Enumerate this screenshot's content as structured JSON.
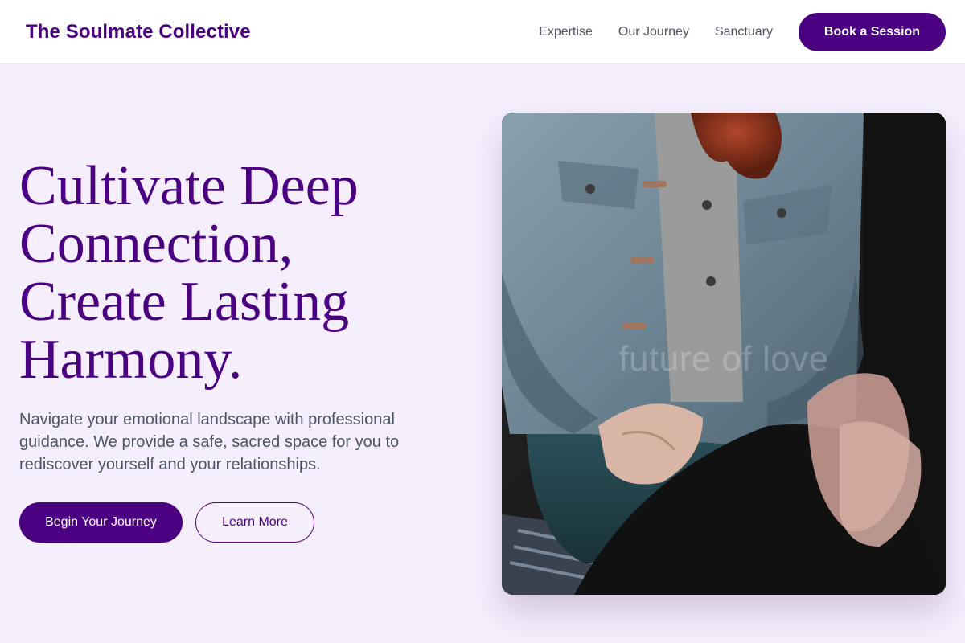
{
  "header": {
    "brand": "The Soulmate Collective",
    "nav": [
      {
        "label": "Expertise"
      },
      {
        "label": "Our Journey"
      },
      {
        "label": "Sanctuary"
      }
    ],
    "cta_label": "Book a Session"
  },
  "hero": {
    "title_lines": [
      "Cultivate Deep",
      "Connection,",
      "Create Lasting",
      "Harmony."
    ],
    "description": "Navigate your emotional landscape with professional guidance. We provide a safe, sacred space for you to rediscover yourself and your relationships.",
    "primary_label": "Begin Your Journey",
    "secondary_label": "Learn More",
    "image_watermark": "future of love"
  },
  "colors": {
    "brand": "#4b0082",
    "background": "#f5eefc",
    "text_muted": "#4b5563"
  }
}
